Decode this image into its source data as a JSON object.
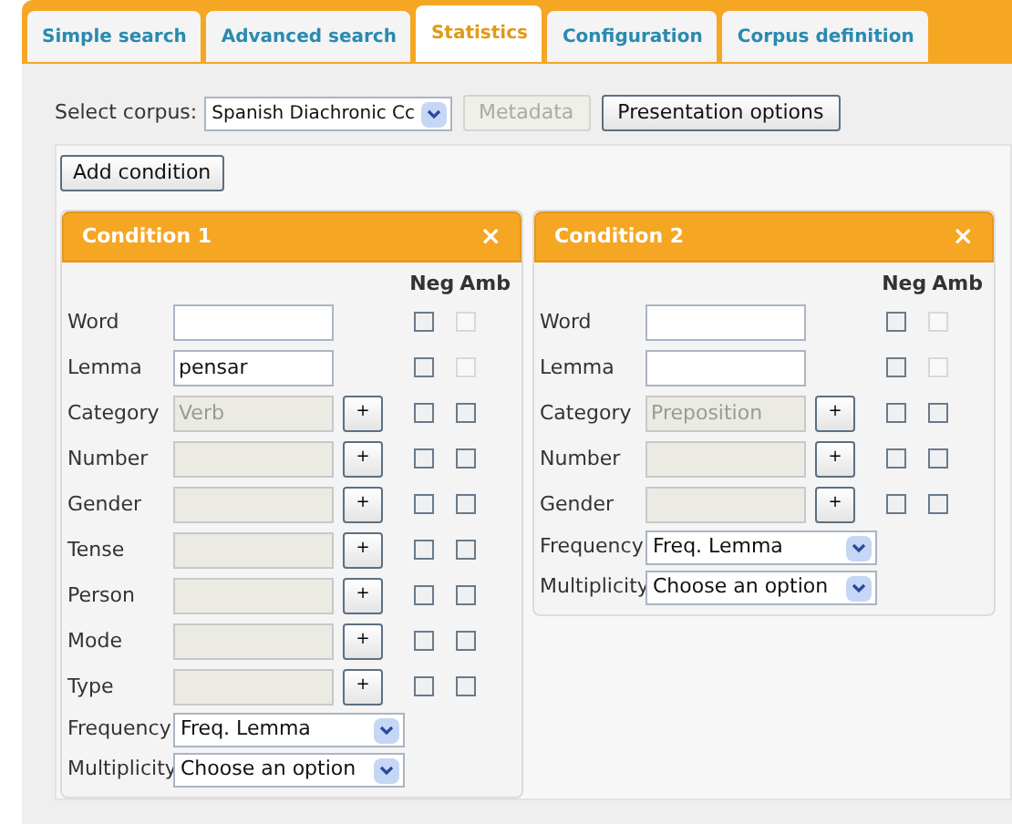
{
  "tabs": [
    {
      "label": "Simple search",
      "selected": false
    },
    {
      "label": "Advanced search",
      "selected": false
    },
    {
      "label": "Statistics",
      "selected": true
    },
    {
      "label": "Configuration",
      "selected": false
    },
    {
      "label": "Corpus definition",
      "selected": false
    }
  ],
  "corpus": {
    "label": "Select corpus:",
    "value": "Spanish Diachronic Cc",
    "metadata": {
      "label": "Metadata",
      "disabled": true
    },
    "presentation": {
      "label": "Presentation options",
      "disabled": false
    }
  },
  "add_condition": "Add condition",
  "conditions": [
    {
      "title": "Condition 1",
      "close": "×",
      "neg_header": "Neg",
      "amb_header": "Amb",
      "fields": [
        {
          "kind": "text",
          "label": "Word",
          "neg": false,
          "amb": false,
          "amb_disabled": true
        },
        {
          "kind": "text",
          "label": "Lemma",
          "value": "pensar",
          "neg": false,
          "amb": false,
          "amb_disabled": true
        },
        {
          "kind": "category",
          "label": "Category",
          "value": "Verb",
          "plus": "+",
          "neg": false,
          "amb": false,
          "amb_disabled": false
        },
        {
          "kind": "category",
          "label": "Number",
          "plus": "+",
          "neg": false,
          "amb": false,
          "amb_disabled": false
        },
        {
          "kind": "category",
          "label": "Gender",
          "plus": "+",
          "neg": false,
          "amb": false,
          "amb_disabled": false
        },
        {
          "kind": "category",
          "label": "Tense",
          "plus": "+",
          "neg": false,
          "amb": false,
          "amb_disabled": false
        },
        {
          "kind": "category",
          "label": "Person",
          "plus": "+",
          "neg": false,
          "amb": false,
          "amb_disabled": false
        },
        {
          "kind": "category",
          "label": "Mode",
          "plus": "+",
          "neg": false,
          "amb": false,
          "amb_disabled": false
        },
        {
          "kind": "category",
          "label": "Type",
          "plus": "+",
          "neg": false,
          "amb": false,
          "amb_disabled": false
        }
      ],
      "selects": [
        {
          "label": "Frequency",
          "value": "Freq. Lemma"
        },
        {
          "label": "Multiplicity",
          "value": "Choose an option"
        }
      ]
    },
    {
      "title": "Condition 2",
      "close": "×",
      "neg_header": "Neg",
      "amb_header": "Amb",
      "fields": [
        {
          "kind": "text",
          "label": "Word",
          "neg": false,
          "amb": false,
          "amb_disabled": true
        },
        {
          "kind": "text",
          "label": "Lemma",
          "neg": false,
          "amb": false,
          "amb_disabled": true
        },
        {
          "kind": "category",
          "label": "Category",
          "value": "Preposition",
          "plus": "+",
          "neg": false,
          "amb": false,
          "amb_disabled": false
        },
        {
          "kind": "category",
          "label": "Number",
          "plus": "+",
          "neg": false,
          "amb": false,
          "amb_disabled": false
        },
        {
          "kind": "category",
          "label": "Gender",
          "plus": "+",
          "neg": false,
          "amb": false,
          "amb_disabled": false
        }
      ],
      "selects": [
        {
          "label": "Frequency",
          "value": "Freq. Lemma"
        },
        {
          "label": "Multiplicity",
          "value": "Choose an option"
        }
      ]
    }
  ]
}
